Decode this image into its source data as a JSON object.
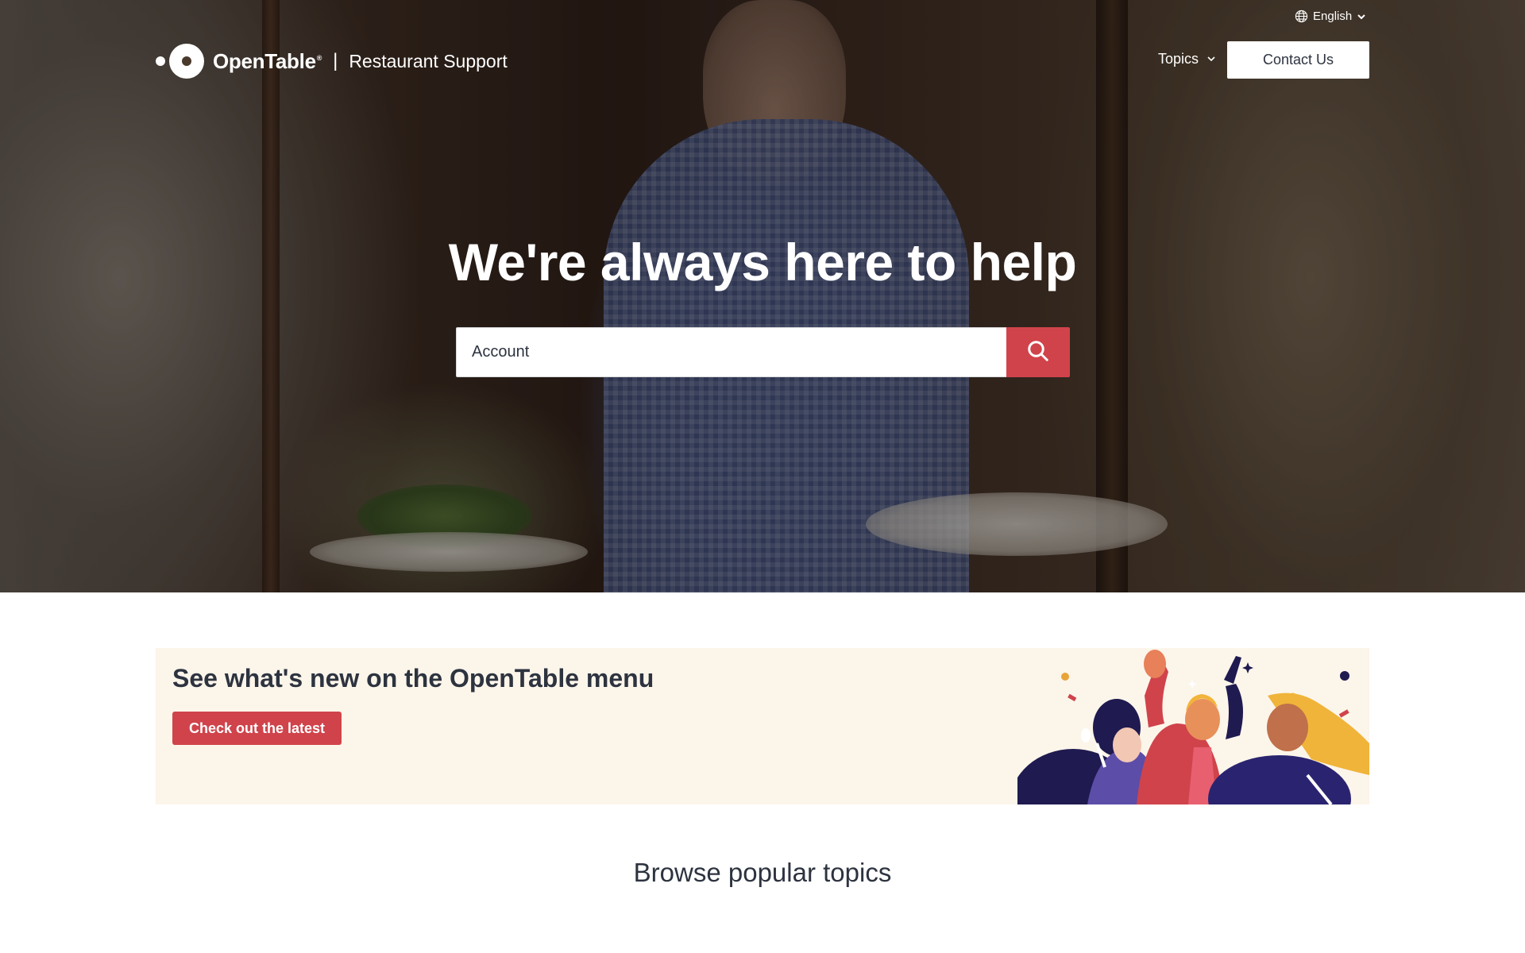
{
  "header": {
    "language": "English",
    "logo_name": "OpenTable",
    "logo_registered": "®",
    "separator": "|",
    "logo_subtitle": "Restaurant Support",
    "topics_label": "Topics",
    "contact_label": "Contact Us"
  },
  "hero": {
    "title": "We're always here to help",
    "search_value": "Account"
  },
  "promo": {
    "title": "See what's new on the OpenTable menu",
    "button_label": "Check out the latest"
  },
  "browse": {
    "title": "Browse popular topics"
  },
  "colors": {
    "accent_red": "#d0434b",
    "promo_background": "#fcf5ea",
    "text_dark": "#2d333f"
  },
  "icons": {
    "language": "globe-icon",
    "language_dropdown": "chevron-down-icon",
    "topics_dropdown": "chevron-down-icon",
    "search": "search-icon"
  }
}
